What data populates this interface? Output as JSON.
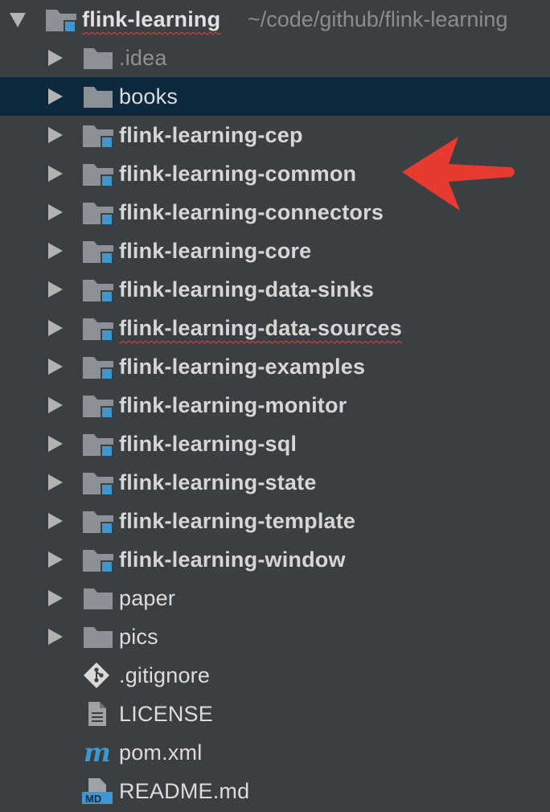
{
  "project": {
    "name": "flink-learning",
    "path": "~/code/github/flink-learning"
  },
  "items": [
    {
      "label": ".idea",
      "kind": "folder",
      "style": "dim"
    },
    {
      "label": "books",
      "kind": "folder",
      "style": "normal",
      "selected": true
    },
    {
      "label": "flink-learning-cep",
      "kind": "module",
      "style": "bold"
    },
    {
      "label": "flink-learning-common",
      "kind": "module",
      "style": "bold"
    },
    {
      "label": "flink-learning-connectors",
      "kind": "module",
      "style": "bold"
    },
    {
      "label": "flink-learning-core",
      "kind": "module",
      "style": "bold"
    },
    {
      "label": "flink-learning-data-sinks",
      "kind": "module",
      "style": "bold"
    },
    {
      "label": "flink-learning-data-sources",
      "kind": "module",
      "style": "bold",
      "squiggle": true
    },
    {
      "label": "flink-learning-examples",
      "kind": "module",
      "style": "bold"
    },
    {
      "label": "flink-learning-monitor",
      "kind": "module",
      "style": "bold"
    },
    {
      "label": "flink-learning-sql",
      "kind": "module",
      "style": "bold"
    },
    {
      "label": "flink-learning-state",
      "kind": "module",
      "style": "bold"
    },
    {
      "label": "flink-learning-template",
      "kind": "module",
      "style": "bold"
    },
    {
      "label": "flink-learning-window",
      "kind": "module",
      "style": "bold"
    },
    {
      "label": "paper",
      "kind": "folder",
      "style": "normal"
    },
    {
      "label": "pics",
      "kind": "folder",
      "style": "normal"
    },
    {
      "label": ".gitignore",
      "kind": "gitignore",
      "style": "normal"
    },
    {
      "label": "LICENSE",
      "kind": "text-file",
      "style": "normal"
    },
    {
      "label": "pom.xml",
      "kind": "maven",
      "style": "normal"
    },
    {
      "label": "README.md",
      "kind": "markdown",
      "style": "normal"
    }
  ],
  "colors": {
    "background": "#3c3f41",
    "selection": "#0d293e",
    "folder": "#8b9196",
    "module_badge": "#3e97d1",
    "annotation_arrow": "#e63b2e"
  }
}
